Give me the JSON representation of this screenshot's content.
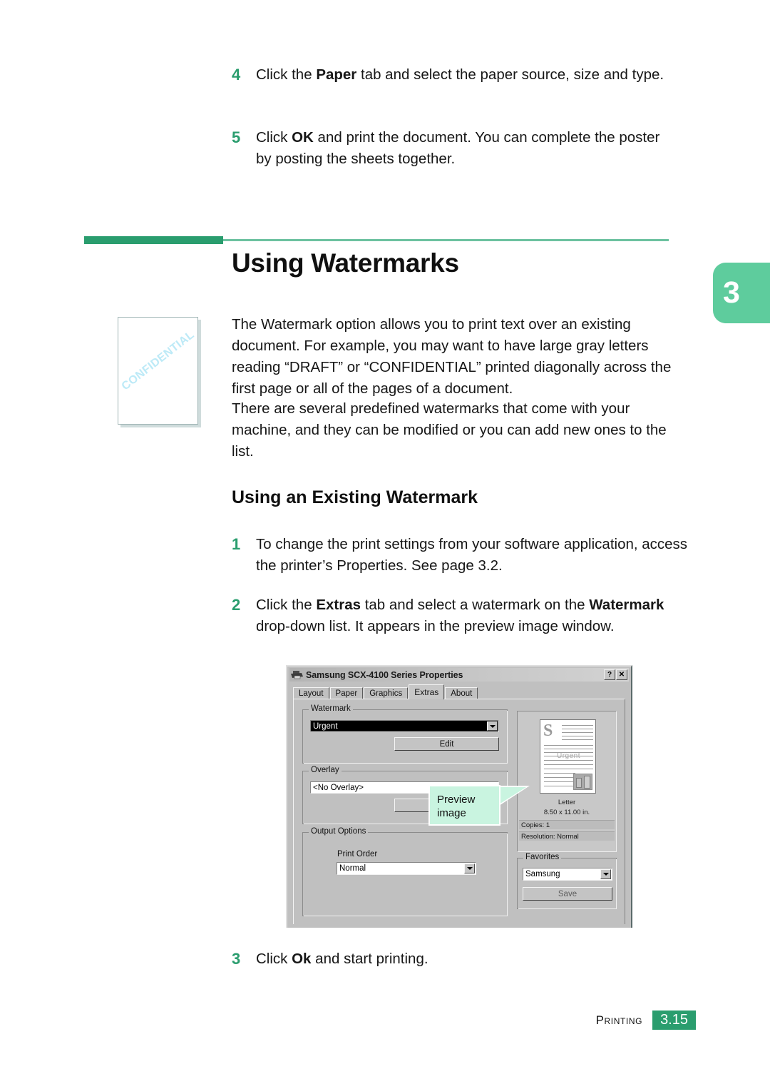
{
  "top_steps": [
    {
      "num": "4",
      "html": "Click the <b>Paper</b> tab and select the paper source, size and type.",
      "text": "Click the Paper tab and select the paper source, size and type."
    },
    {
      "num": "5",
      "html": "Click <b>OK</b> and print the document. You can complete the poster by posting the sheets together.",
      "text": "Click OK and print the document. You can complete the poster by posting the sheets together."
    }
  ],
  "section": {
    "title": "Using Watermarks",
    "subtitle": "Using an Existing Watermark",
    "chapter_number": "3",
    "accent_dark": "#2a9d6e",
    "accent_light": "#6cc2a0",
    "tab_green": "#5ecc9d"
  },
  "thumbnail": {
    "watermark_text": "CONFIDENTIAL",
    "watermark_color": "#bdeaf7"
  },
  "paragraphs": [
    "The Watermark option allows you to print text over an existing document. For example, you may want to have large gray letters reading “DRAFT” or “CONFIDENTIAL” printed diagonally across the first page or all of the pages of a document.",
    "There are several predefined watermarks that come with your machine, and they can be modified or you can add new ones to the list."
  ],
  "numbered_steps": [
    {
      "num": "1",
      "html": "To change the print settings from your software application, access the printer’s Properties. See page 3.2.",
      "text": "To change the print settings from your software application, access the printer’s Properties. See page 3.2."
    },
    {
      "num": "2",
      "html": "Click the <b>Extras</b> tab and select a watermark on the <b>Watermark</b> drop-down list. It appears in the preview image window.",
      "text": "Click the Extras tab and select a watermark on the Watermark drop-down list. It appears in the preview image window."
    },
    {
      "num": "3",
      "html": "Click <b>Ok</b> and start printing.",
      "text": "Click Ok and start printing."
    }
  ],
  "dialog": {
    "title": "Samsung SCX-4100 Series Properties",
    "help_button": "?",
    "close_button": "✕",
    "tabs": [
      {
        "label": "Layout",
        "active": false
      },
      {
        "label": "Paper",
        "active": false
      },
      {
        "label": "Graphics",
        "active": false
      },
      {
        "label": "Extras",
        "active": true
      },
      {
        "label": "About",
        "active": false
      }
    ],
    "watermark_group": {
      "label": "Watermark",
      "selected_value": "Urgent",
      "edit_button": "Edit"
    },
    "overlay_group": {
      "label": "Overlay",
      "selected_value": "<No Overlay>"
    },
    "output_options_group": {
      "label": "Output Options",
      "print_order_label": "Print Order",
      "print_order_value": "Normal"
    },
    "preview": {
      "page_logo": "S",
      "watermark_text": "Urgent",
      "paper_name": "Letter",
      "paper_size": "8.50 x 11.00 in.",
      "copies": "Copies: 1",
      "resolution": "Resolution: Normal"
    },
    "favorites_group": {
      "label": "Favorites",
      "selected_value": "Samsung",
      "save_button": "Save"
    }
  },
  "callout": {
    "line1": "Preview",
    "line2": "image",
    "fill": "#c9f4e0"
  },
  "footer": {
    "label": "Printing",
    "page_number": "3.15",
    "page_box_color": "#2a9d6e"
  }
}
